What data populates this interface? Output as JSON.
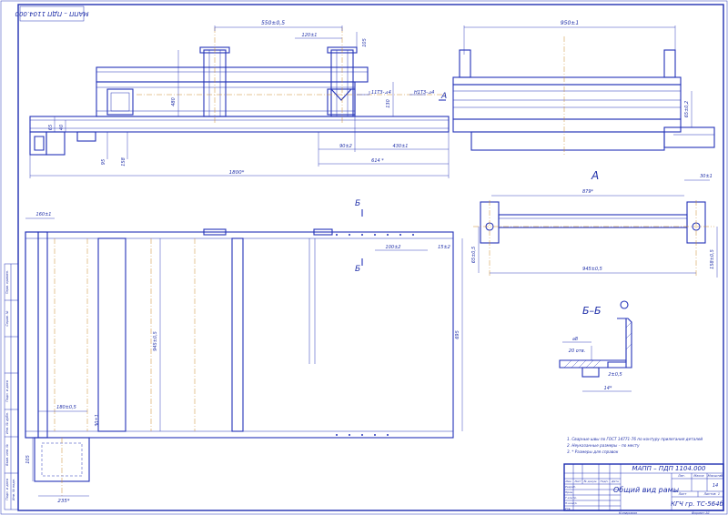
{
  "drawing": {
    "designation": "МАПП – ПДП 1104.000",
    "title": "Общий вид рамы",
    "group": "КГЧ гр. ТС-564б",
    "sheet_count": "14",
    "scale": "1",
    "copied": "Копировал",
    "format": "Формат А1"
  },
  "dimensions": {
    "top_550": "550±0,5",
    "top_120": "120±1",
    "top_105": "105",
    "top_480": "480",
    "top_130": "130",
    "top_65": "65",
    "top_40": "40",
    "top_95": "95",
    "top_158": "158",
    "top_90": "90±2",
    "top_430": "430±1",
    "top_614": "614 *",
    "top_1800": "1800*",
    "weld_1": "11Т3-⊿4",
    "weld_2": "Н1Т3-⊿4",
    "side_950": "950±1",
    "side_65": "65±0,2",
    "plan_160": "160±1",
    "plan_100": "100±2",
    "plan_15": "15±2",
    "plan_945": "945±0,5",
    "plan_695": "695",
    "plan_180": "180±0,5",
    "plan_30": "30±1",
    "plan_105": "105",
    "plan_235": "235*",
    "a_879": "879*",
    "a_30": "30±1",
    "a_65": "65±0,5",
    "a_158": "158±0,5",
    "a_945": "945±0,5",
    "s_8": "⌀8",
    "s_20": "20 отв.",
    "s_2": "2±0,5",
    "s_14": "14*"
  },
  "labels": {
    "view_a": "А",
    "view_a_arrow": "А",
    "section_b_top": "Б",
    "section_b_bottom": "Б",
    "section_bb": "Б–Б"
  },
  "notes": [
    "1. Сварные швы по ГОСТ 14771-76 по контуру прилегания деталей",
    "2. Неуказанные размеры – по месту",
    "3. * Размеры для справок"
  ],
  "title_block": {
    "col_izm": "Изм.",
    "col_list": "Лист",
    "col_doc": "№ докум.",
    "col_sign": "Подп.",
    "col_date": "Дата",
    "row_razrab": "Разраб.",
    "row_prov": "Пров.",
    "row_tkontr": "Т.контр.",
    "row_nkontr": "Н.контр.",
    "row_utv": "Утв.",
    "lit": "Лит.",
    "mass": "Масса",
    "scale_h": "Масштаб",
    "list": "Лист",
    "lists": "Листов"
  },
  "side_strip": [
    "Перв. примен.",
    "Справ. №",
    "Подп. и дата",
    "Инв. № дубл.",
    "Взам. инв. №",
    "Подп. и дата",
    "Инв. № подл."
  ],
  "corner_stamp": "МАПП – ПДП 1104.000"
}
